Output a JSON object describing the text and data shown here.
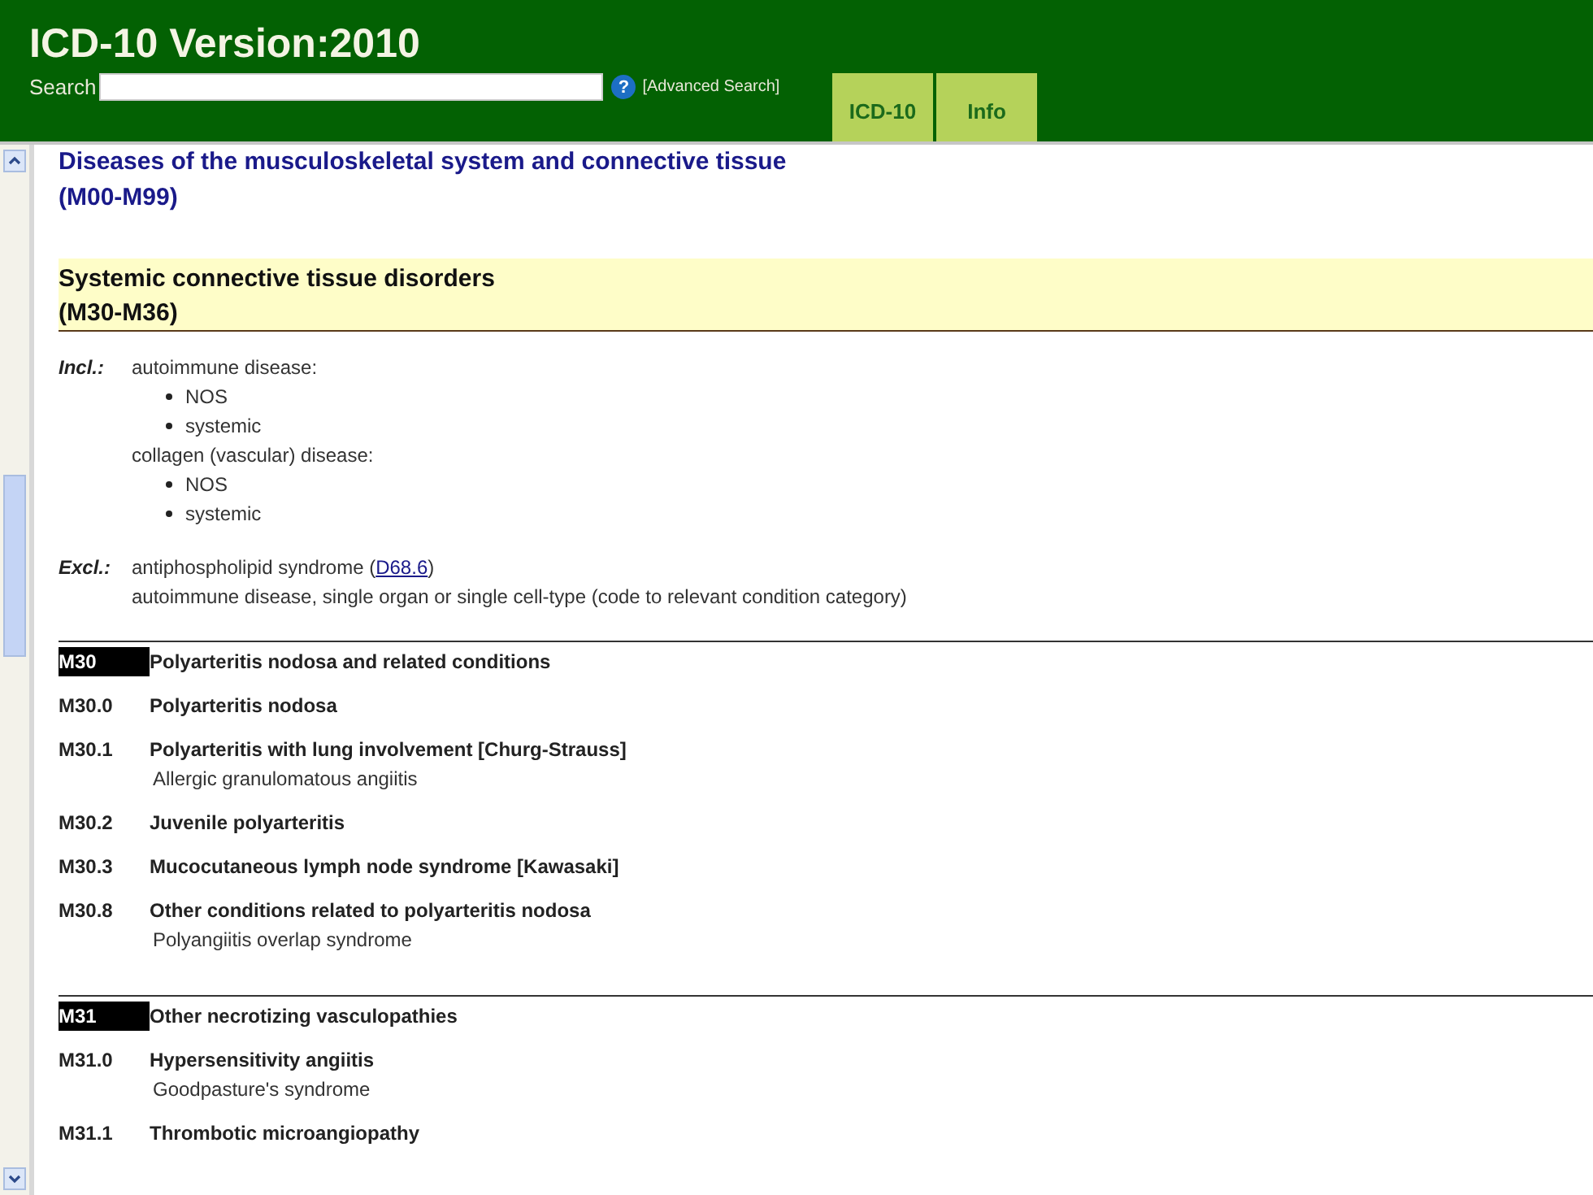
{
  "header": {
    "title": "ICD-10 Version:2010",
    "search": {
      "label": "Search"
    },
    "help": "?",
    "advanced_search": "[Advanced Search]"
  },
  "tabs": [
    {
      "label": "ICD-10",
      "selected": false
    },
    {
      "label": "Info",
      "selected": false
    }
  ],
  "chapter": {
    "title": "Diseases of the musculoskeletal system and connective tissue",
    "range": "(M00-M99)"
  },
  "block": {
    "title": "Systemic connective tissue disorders",
    "range": "(M30-M36)"
  },
  "includes": {
    "label": "Incl.:",
    "items": [
      {
        "text": "autoimmune disease:",
        "children": [
          {
            "text": "NOS"
          },
          {
            "text": "systemic"
          }
        ]
      },
      {
        "text": "collagen (vascular) disease:",
        "children": [
          {
            "text": "NOS"
          },
          {
            "text": "systemic"
          }
        ]
      }
    ]
  },
  "excludes": {
    "label": "Excl.:",
    "items": [
      {
        "text": "antiphospholipid syndrome (",
        "link": "D68.6",
        "after": ")"
      },
      {
        "text": "autoimmune disease, single organ or single cell-type (code to relevant condition category)"
      }
    ]
  },
  "categories": [
    {
      "kind": "block",
      "code": "M30",
      "title": "Polyarteritis nodosa and related conditions"
    },
    {
      "kind": "sub",
      "code": "M30.0",
      "title": "Polyarteritis nodosa"
    },
    {
      "kind": "sub",
      "code": "M30.1",
      "title": "Polyarteritis with lung involvement [Churg-Strauss]",
      "note": "Allergic granulomatous angiitis"
    },
    {
      "kind": "sub",
      "code": "M30.2",
      "title": "Juvenile polyarteritis"
    },
    {
      "kind": "sub",
      "code": "M30.3",
      "title": "Mucocutaneous lymph node syndrome [Kawasaki]"
    },
    {
      "kind": "sub",
      "code": "M30.8",
      "title": "Other conditions related to polyarteritis nodosa",
      "note": "Polyangiitis overlap syndrome"
    },
    {
      "kind": "block",
      "code": "M31",
      "title": "Other necrotizing vasculopathies"
    },
    {
      "kind": "sub",
      "code": "M31.0",
      "title": "Hypersensitivity angiitis",
      "note": "Goodpasture's syndrome"
    },
    {
      "kind": "sub",
      "code": "M31.1",
      "title": "Thrombotic microangiopathy"
    }
  ]
}
